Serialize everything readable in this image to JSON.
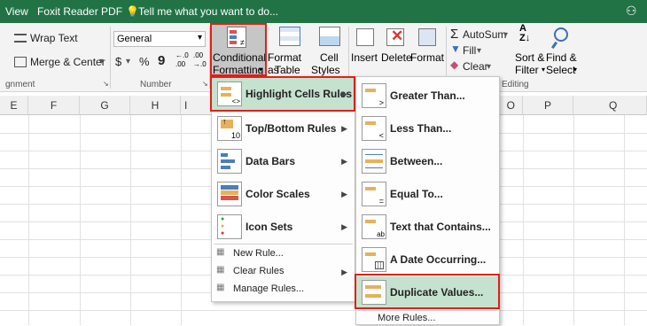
{
  "titlebar": {
    "view": "View",
    "foxit": "Foxit Reader PDF",
    "tell": "Tell me what you want to do..."
  },
  "ribbon": {
    "wrap_text": "Wrap Text",
    "merge_center": "Merge & Center",
    "number_format": "General",
    "dollar": "$",
    "percent": "%",
    "comma": "9",
    "inc_decimal_a": "←.0",
    "inc_decimal_b": ".00",
    "dec_decimal_a": ".00",
    "dec_decimal_b": "→.0",
    "cond_format_1": "Conditional",
    "cond_format_2": "Formatting",
    "format_as_1": "Format as",
    "format_as_2": "Table",
    "cell_1": "Cell",
    "cell_2": "Styles",
    "insert": "Insert",
    "delete": "Delete",
    "format": "Format",
    "autosum": "AutoSum",
    "fill": "Fill",
    "clear": "Clear",
    "sort_1": "Sort &",
    "sort_2": "Filter",
    "find_1": "Find &",
    "find_2": "Select",
    "group_alignment": "gnment",
    "group_number": "Number",
    "group_editing": "Editing"
  },
  "columns": [
    "E",
    "F",
    "G",
    "H",
    "I",
    "O",
    "P",
    "Q"
  ],
  "menu_main": {
    "items": [
      {
        "label": "Highlight Cells Rules",
        "icon": "highlight-cells-icon"
      },
      {
        "label": "Top/Bottom Rules",
        "icon": "top-bottom-icon"
      },
      {
        "label": "Data Bars",
        "icon": "data-bars-icon"
      },
      {
        "label": "Color Scales",
        "icon": "color-scales-icon"
      },
      {
        "label": "Icon Sets",
        "icon": "icon-sets-icon"
      }
    ],
    "small_items": [
      {
        "label": "New Rule..."
      },
      {
        "label": "Clear Rules"
      },
      {
        "label": "Manage Rules..."
      }
    ]
  },
  "menu_sub": {
    "items": [
      {
        "label": "Greater Than...",
        "icon": "greater-than-icon"
      },
      {
        "label": "Less Than...",
        "icon": "less-than-icon"
      },
      {
        "label": "Between...",
        "icon": "between-icon"
      },
      {
        "label": "Equal To...",
        "icon": "equal-to-icon"
      },
      {
        "label": "Text that Contains...",
        "icon": "text-contains-icon"
      },
      {
        "label": "A Date Occurring...",
        "icon": "date-occurring-icon"
      },
      {
        "label": "Duplicate Values...",
        "icon": "duplicate-values-icon"
      }
    ],
    "more": "More Rules..."
  },
  "colors": {
    "title_bg": "#217346",
    "highlight": "#c5e2cf",
    "red_box": "#e0201a"
  }
}
